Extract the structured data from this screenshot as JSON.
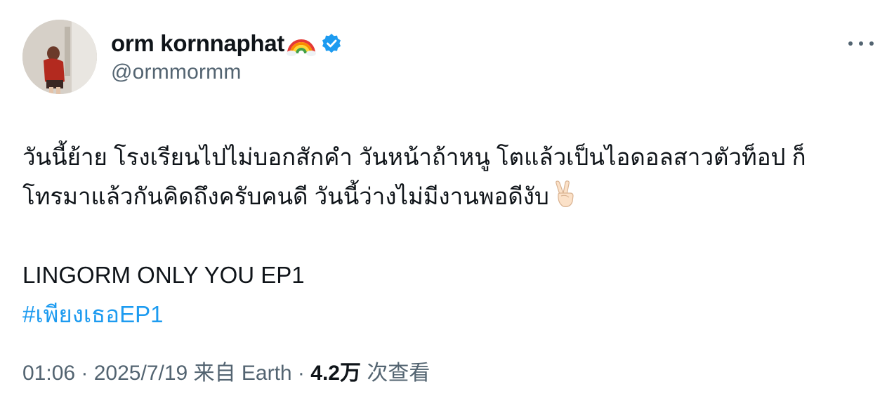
{
  "author": {
    "display_name": "orm kornnaphat",
    "name_emoji": "rainbow-icon",
    "verified_badge": "verified-icon",
    "handle": "@ormmormm",
    "avatar": "profile-photo"
  },
  "tweet": {
    "line1": "วันนี้ย้าย โรงเรียนไปไม่บอกสักคำ วันหน้าถ้าหนู โตแล้วเป็นไอดอลสาวตัวท็อป ก็",
    "line2": "โทรมาแล้วกันคิดถึงครับคนดี วันนี้ว่างไม่มีงานพอดีงับ",
    "line2_emoji": "peace-hand-icon",
    "line3": "LINGORM ONLY YOU EP1",
    "hashtag": "#เพียงเธอEP1"
  },
  "meta": {
    "time": "01:06",
    "sep1": " · ",
    "date": "2025/7/19",
    "location": " 来自 Earth",
    "sep2": " · ",
    "views_count": "4.2万",
    "views_label": " 次查看"
  },
  "colors": {
    "text": "#0f1419",
    "secondary": "#536471",
    "link": "#1d9bf0",
    "verified": "#1d9bf0"
  }
}
